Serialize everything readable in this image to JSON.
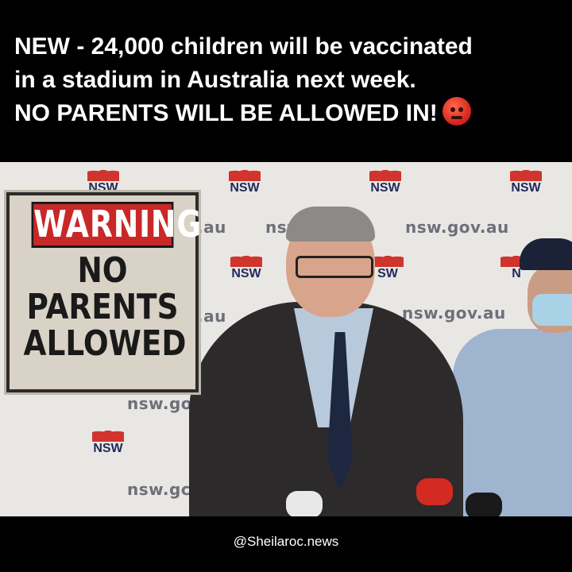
{
  "headline": {
    "line1": "NEW - 24,000 children will be vaccinated",
    "line2": "in a stadium in Australia next week.",
    "line3": "NO PARENTS WILL BE ALLOWED IN!",
    "emoji": "angry-face-icon"
  },
  "backdrop": {
    "logo_text": "NSW",
    "url_text": "nsw.gov.au",
    "url_partial_1": ".au",
    "url_partial_2": "nsw.gov",
    "url_partial_3": "nsw.gc",
    "url_partial_4": "nsw",
    "url_partial_5": "ns",
    "logo_partial": "SW",
    "logo_partial_2": "N",
    "logo_partial_3": "NSW"
  },
  "sign": {
    "banner": "WARNING",
    "line1": "NO",
    "line2": "PARENTS",
    "line3": "ALLOWED"
  },
  "footer": {
    "handle": "@Sheilaroc.news"
  },
  "colors": {
    "sign_red": "#c82828",
    "backdrop_red": "#d0342c",
    "nsw_blue": "#222a5a"
  }
}
